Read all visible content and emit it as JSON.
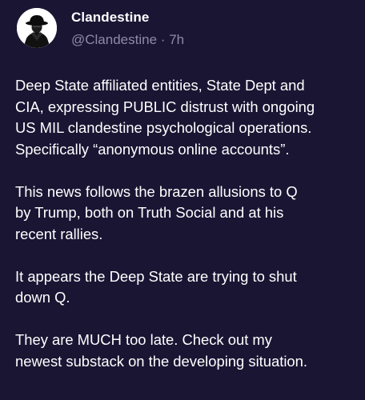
{
  "post": {
    "author": {
      "display_name": "Clandestine",
      "handle": "@Clandestine",
      "separator": "·",
      "timestamp": "7h",
      "avatar_icon": "spy-silhouette-icon"
    },
    "paragraphs": [
      "Deep State affiliated entities, State Dept and\nCIA, expressing PUBLIC distrust with ongoing\nUS MIL clandestine psychological operations.\nSpecifically “anonymous online accounts”.",
      "This news follows the brazen allusions to Q\nby Trump, both on Truth Social and at his\nrecent rallies.",
      "It appears the Deep State are trying to shut\ndown Q.",
      "They are MUCH too late. Check out my\nnewest substack on the developing situation."
    ]
  },
  "colors": {
    "background": "#1a1533",
    "text": "#ffffff",
    "muted": "#8d8aa6"
  }
}
